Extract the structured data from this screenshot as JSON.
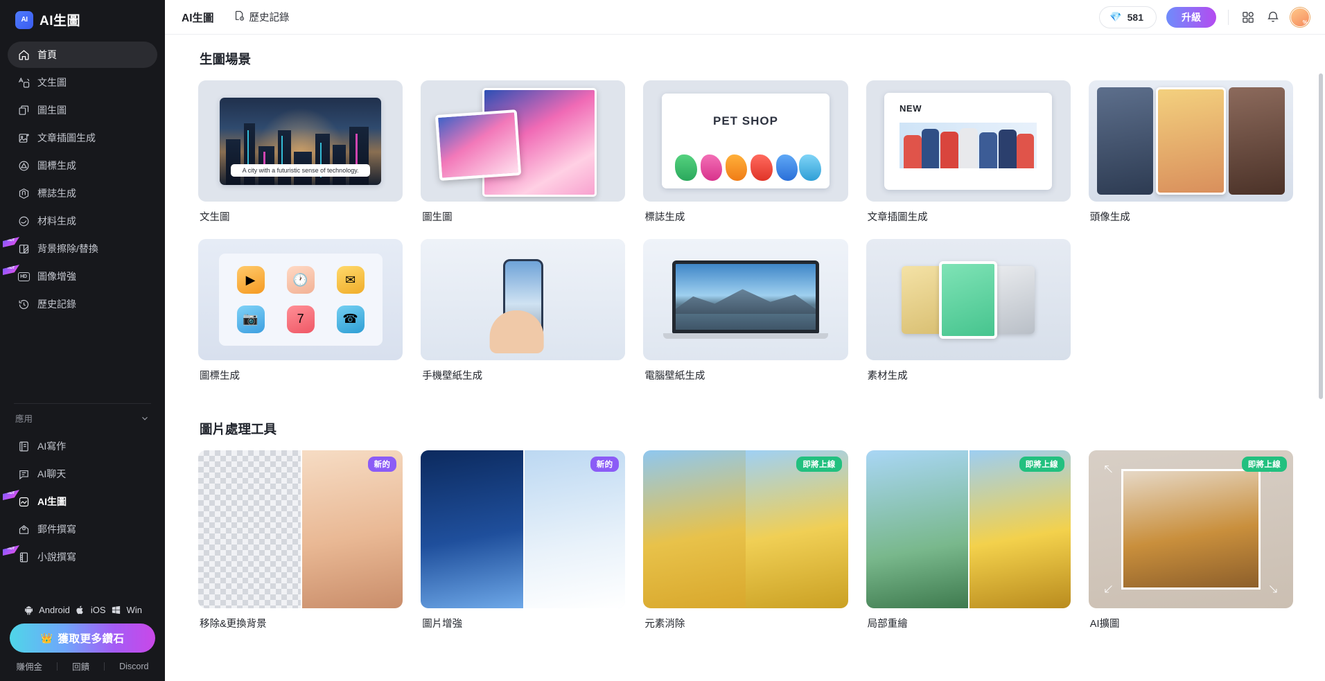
{
  "sidebar": {
    "brand": {
      "mark": "AI",
      "title": "AI生圖"
    },
    "items": [
      {
        "label": "首頁",
        "icon": "home-icon",
        "active": true,
        "hot": false
      },
      {
        "label": "文生圖",
        "icon": "text-to-image-icon",
        "active": false,
        "hot": false
      },
      {
        "label": "圖生圖",
        "icon": "image-to-image-icon",
        "active": false,
        "hot": false
      },
      {
        "label": "文章插圖生成",
        "icon": "article-illustration-icon",
        "active": false,
        "hot": false
      },
      {
        "label": "圖標生成",
        "icon": "icon-generate-icon",
        "active": false,
        "hot": false
      },
      {
        "label": "標誌生成",
        "icon": "logo-generate-icon",
        "active": false,
        "hot": false
      },
      {
        "label": "材料生成",
        "icon": "material-generate-icon",
        "active": false,
        "hot": false
      },
      {
        "label": "背景擦除/替換",
        "icon": "background-remove-icon",
        "active": false,
        "hot": true
      },
      {
        "label": "圖像增強",
        "icon": "hd-enhance-icon",
        "active": false,
        "hot": true
      },
      {
        "label": "歷史記錄",
        "icon": "history-icon",
        "active": false,
        "hot": false
      }
    ],
    "group": {
      "label": "應用",
      "chevron": "chevron-down-icon"
    },
    "apps": [
      {
        "label": "AI寫作",
        "icon": "ai-writing-icon",
        "hot": false,
        "bold": false
      },
      {
        "label": "AI聊天",
        "icon": "ai-chat-icon",
        "hot": false,
        "bold": false
      },
      {
        "label": "AI生圖",
        "icon": "ai-image-icon",
        "hot": true,
        "bold": true
      },
      {
        "label": "郵件撰寫",
        "icon": "mail-write-icon",
        "hot": false,
        "bold": false
      },
      {
        "label": "小說撰寫",
        "icon": "novel-write-icon",
        "hot": true,
        "bold": false
      }
    ],
    "platforms": [
      {
        "label": "Android",
        "icon": "android-icon"
      },
      {
        "label": "iOS",
        "icon": "apple-icon"
      },
      {
        "label": "Win",
        "icon": "windows-icon"
      }
    ],
    "gem_button": {
      "label": "獲取更多鑽石",
      "icon": "crown-icon"
    },
    "footer_links": [
      "賺佣金",
      "回饋",
      "Discord"
    ],
    "hot_flag_text": "HOT"
  },
  "topbar": {
    "title": "AI生圖",
    "history": {
      "label": "歷史記錄",
      "icon": "history-doc-icon"
    },
    "credits": {
      "value": "581",
      "icon": "diamond-icon"
    },
    "upgrade_label": "升級",
    "apps_grid_icon": "grid-apps-icon",
    "bell_icon": "bell-icon",
    "avatar": "user-avatar"
  },
  "main": {
    "sections": [
      {
        "title": "生圖場景",
        "cards": [
          {
            "label": "文生圖",
            "thumb": "city-prompt-thumb",
            "caption": "A city with a futuristic sense of technology.",
            "badge": null
          },
          {
            "label": "圖生圖",
            "thumb": "anime-stack-thumb",
            "badge": null
          },
          {
            "label": "標誌生成",
            "thumb": "petshop-logo-thumb",
            "logo_text": "PET SHOP",
            "badge": null
          },
          {
            "label": "文章插圖生成",
            "thumb": "article-people-thumb",
            "new_text": "NEW",
            "badge": null
          },
          {
            "label": "頭像生成",
            "thumb": "avatars-thumb",
            "badge": null
          },
          {
            "label": "圖標生成",
            "thumb": "icon-set-thumb",
            "badge": null
          },
          {
            "label": "手機壁紙生成",
            "thumb": "phone-wallpaper-thumb",
            "badge": null
          },
          {
            "label": "電腦壁紙生成",
            "thumb": "laptop-wallpaper-thumb",
            "badge": null
          },
          {
            "label": "素材生成",
            "thumb": "material-set-thumb",
            "badge": null
          }
        ]
      },
      {
        "title": "圖片處理工具",
        "cards": [
          {
            "label": "移除&更換背景",
            "thumb": "bg-remove-thumb",
            "badge": "新的",
            "badge_type": "new"
          },
          {
            "label": "圖片增強",
            "thumb": "enhance-thumb",
            "badge": "新的",
            "badge_type": "new"
          },
          {
            "label": "元素消除",
            "thumb": "object-erase-thumb",
            "badge": "即將上線",
            "badge_type": "soon"
          },
          {
            "label": "局部重繪",
            "thumb": "inpaint-thumb",
            "badge": "即將上線",
            "badge_type": "soon"
          },
          {
            "label": "AI擴圖",
            "thumb": "outpaint-thumb",
            "badge": "即將上線",
            "badge_type": "soon"
          }
        ]
      }
    ]
  },
  "colors": {
    "sidebar_bg": "#17181c",
    "accent_purple": "#8b5cf6",
    "accent_green": "#22c07f",
    "upgrade_gradient_start": "#6f8cfb",
    "upgrade_gradient_end": "#b44bf0"
  }
}
